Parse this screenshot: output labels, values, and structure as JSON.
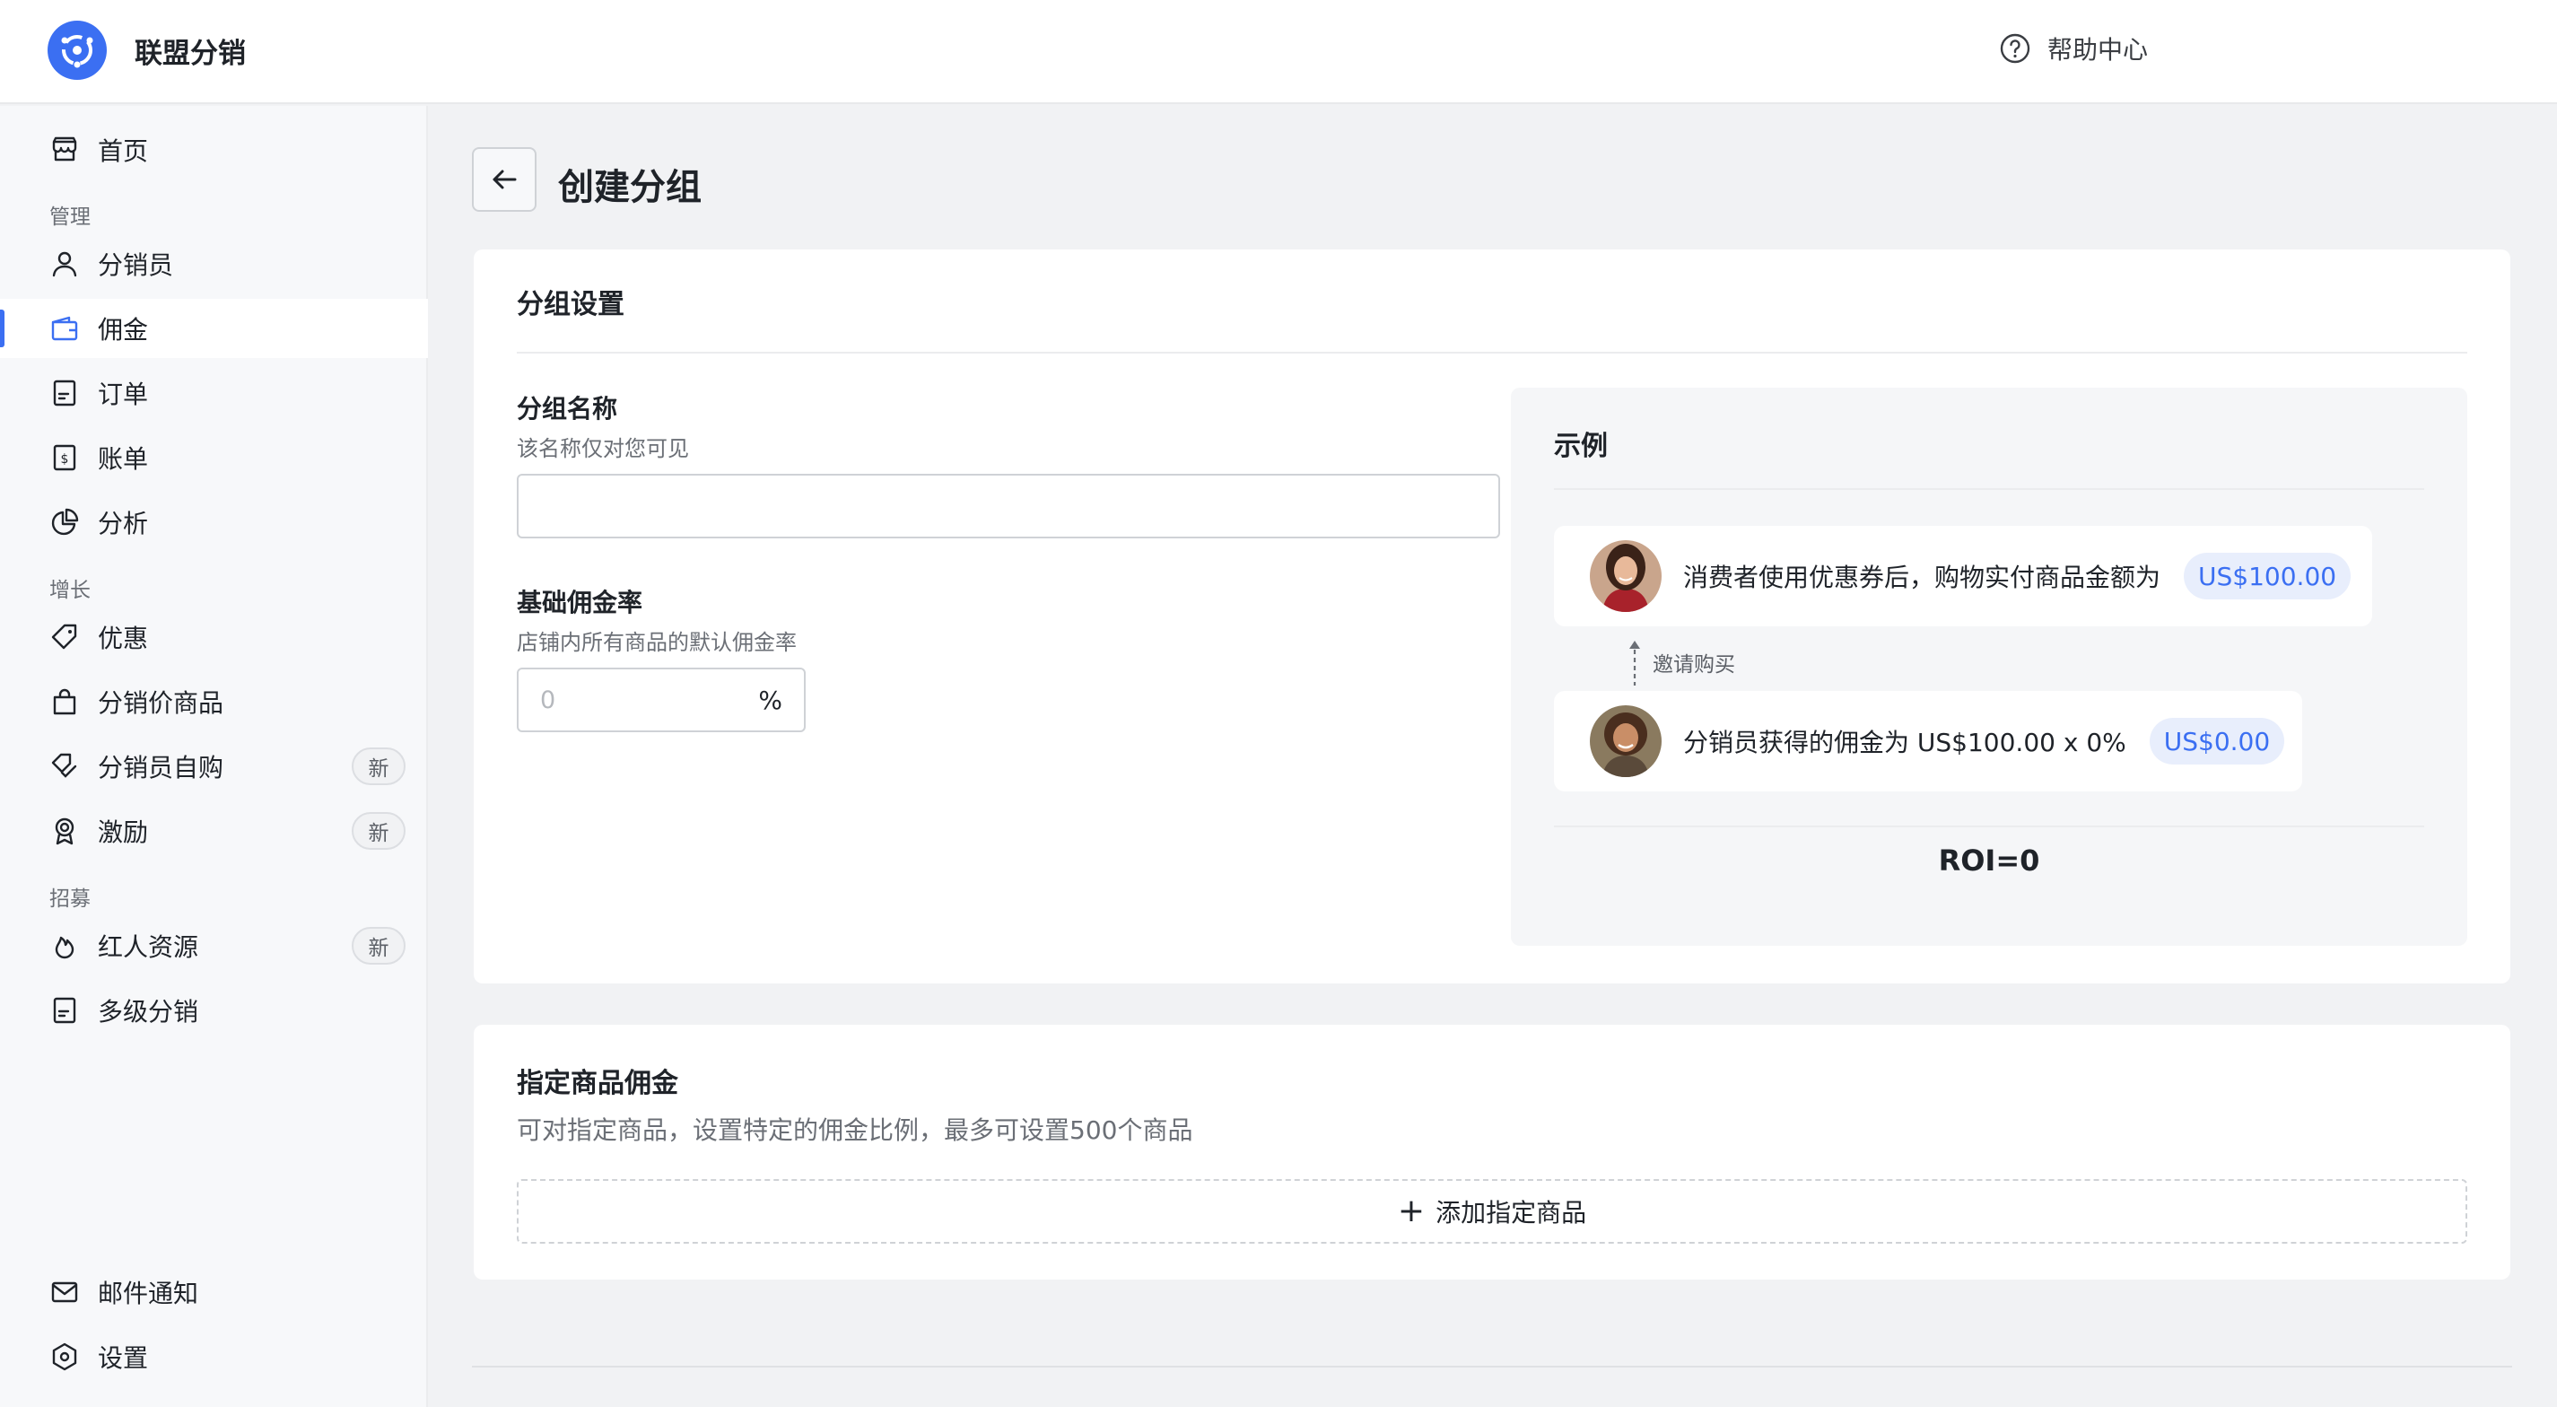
{
  "app": {
    "name": "联盟分销",
    "help_label": "帮助中心"
  },
  "sidebar": {
    "home": "首页",
    "sections": {
      "manage": "管理",
      "growth": "增长",
      "recruit": "招募"
    },
    "items": {
      "affiliates": "分销员",
      "commission": "佣金",
      "orders": "订单",
      "bills": "账单",
      "analytics": "分析",
      "offers": "优惠",
      "affiliate_price_products": "分销价商品",
      "self_purchase": "分销员自购",
      "incentives": "激励",
      "influencer_resources": "红人资源",
      "multilevel": "多级分销",
      "email_notify": "邮件通知",
      "settings": "设置"
    },
    "new_badge": "新"
  },
  "page": {
    "title": "创建分组",
    "group_settings": {
      "title": "分组设置",
      "name_label": "分组名称",
      "name_hint": "该名称仅对您可见",
      "name_value": "",
      "rate_label": "基础佣金率",
      "rate_hint": "店铺内所有商品的默认佣金率",
      "rate_placeholder": "0",
      "rate_unit": "%"
    },
    "example": {
      "title": "示例",
      "consumer_text": "消费者使用优惠券后，购物实付商品金额为",
      "consumer_amount": "US$100.00",
      "invite_label": "邀请购买",
      "affiliate_text": "分销员获得的佣金为 US$100.00 x 0%",
      "affiliate_amount": "US$0.00",
      "roi": "ROI=0"
    },
    "product_commission": {
      "title": "指定商品佣金",
      "subtitle": "可对指定商品，设置特定的佣金比例，最多可设置500个商品",
      "add_label": "添加指定商品"
    }
  },
  "colors": {
    "accent": "#3b6ff2",
    "pill_bg": "#e8eefc"
  }
}
